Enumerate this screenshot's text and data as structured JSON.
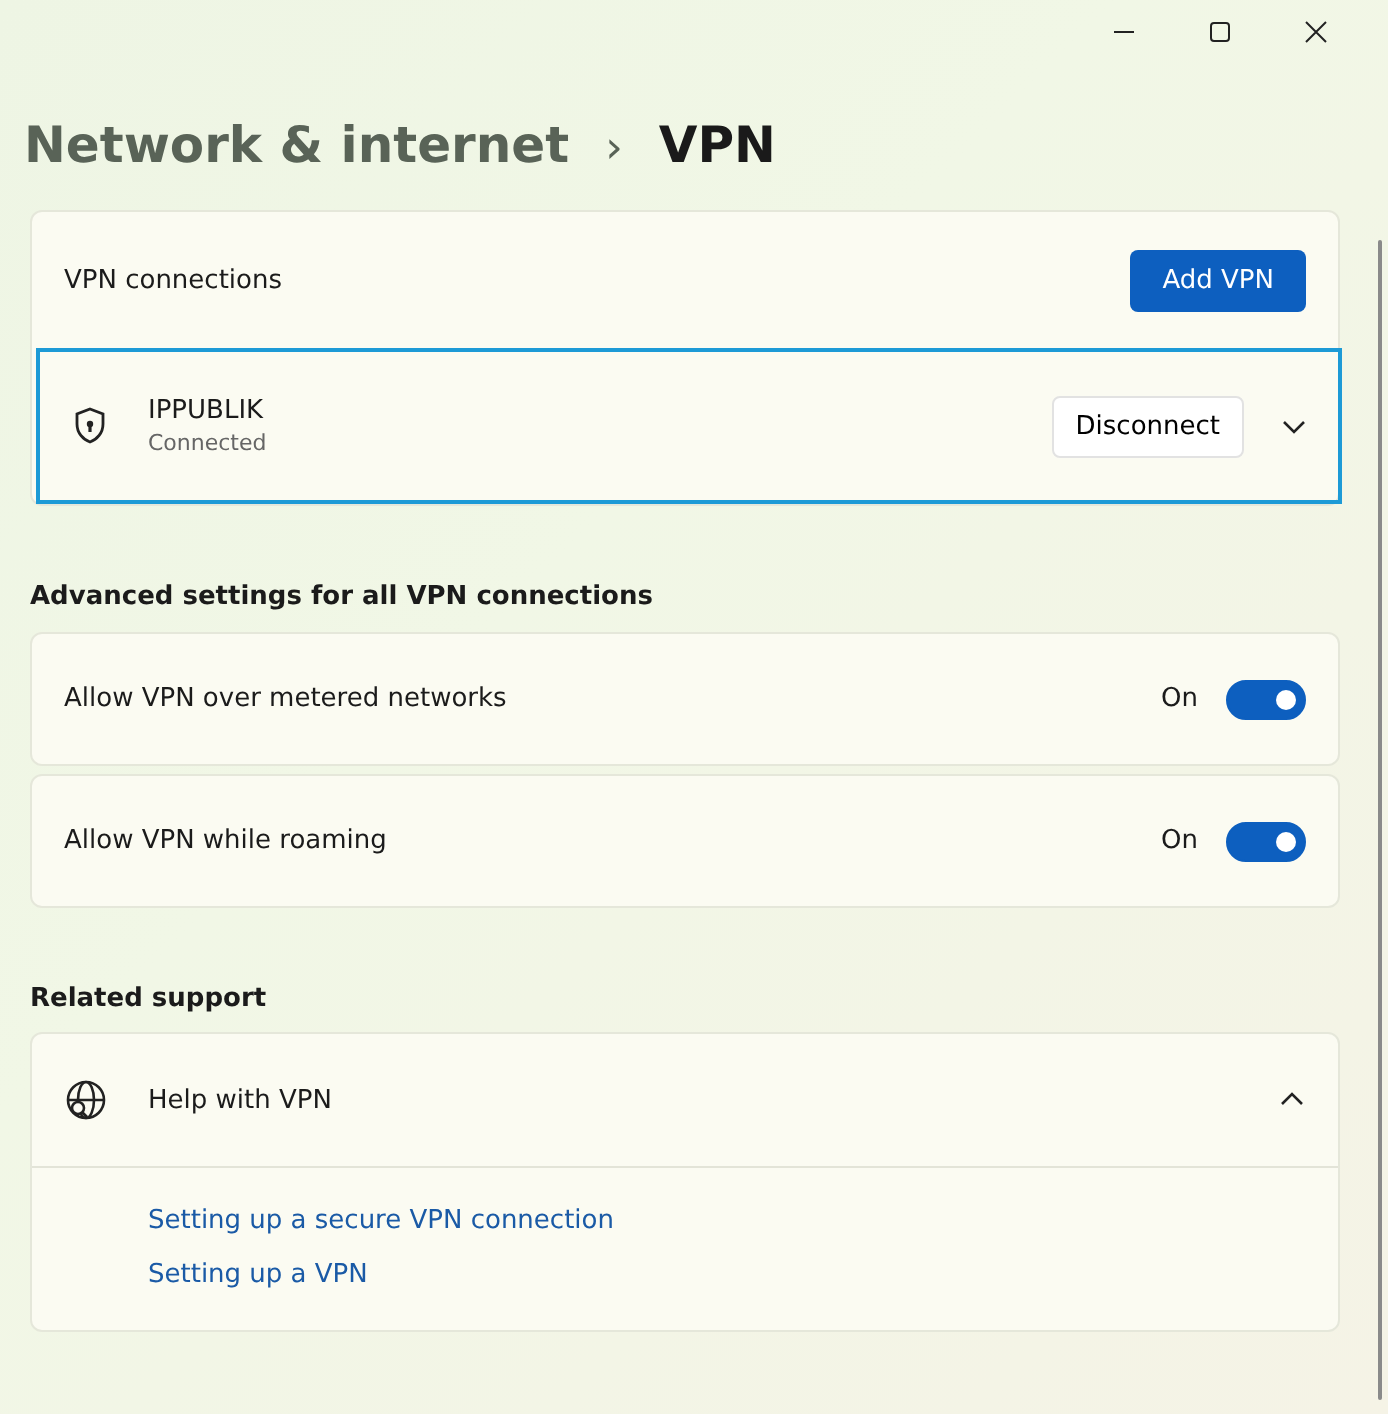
{
  "breadcrumb": {
    "parent": "Network & internet",
    "separator": "›",
    "current": "VPN"
  },
  "vpn_connections": {
    "label": "VPN connections",
    "add_button": "Add VPN",
    "items": [
      {
        "name": "IPPUBLIK",
        "status": "Connected",
        "action": "Disconnect",
        "expanded": false,
        "focused": true
      }
    ]
  },
  "advanced": {
    "heading": "Advanced settings for all VPN connections",
    "settings": [
      {
        "label": "Allow VPN over metered networks",
        "state_text": "On",
        "on": true
      },
      {
        "label": "Allow VPN while roaming",
        "state_text": "On",
        "on": true
      }
    ]
  },
  "related_support": {
    "heading": "Related support",
    "title": "Help with VPN",
    "expanded": true,
    "links": [
      "Setting up a secure VPN connection",
      "Setting up a VPN"
    ]
  }
}
